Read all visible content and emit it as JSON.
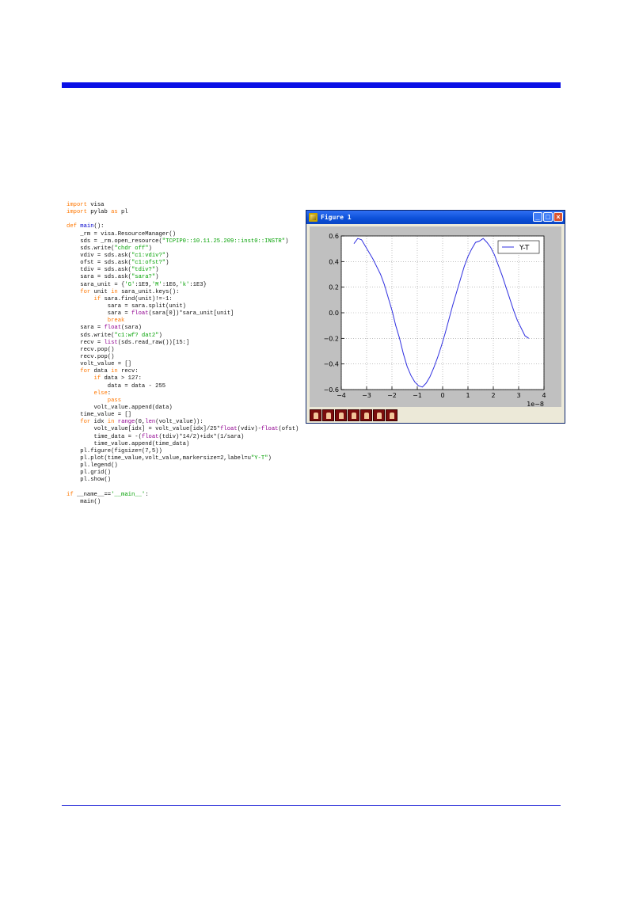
{
  "code_lines": [
    [
      [
        "kw",
        "import"
      ],
      [
        "tx",
        " visa"
      ]
    ],
    [
      [
        "kw",
        "import"
      ],
      [
        "tx",
        " pylab "
      ],
      [
        "kw",
        "as"
      ],
      [
        "tx",
        " pl"
      ]
    ],
    [],
    [
      [
        "kw",
        "def"
      ],
      [
        "tx",
        " "
      ],
      [
        "fn",
        "main"
      ],
      [
        "tx",
        "():"
      ]
    ],
    [
      [
        "tx",
        "    _rm = visa.ResourceManager()"
      ]
    ],
    [
      [
        "tx",
        "    sds = _rm.open_resource("
      ],
      [
        "st",
        "\"TCPIP0::10.11.25.209::inst0::INSTR\""
      ],
      [
        "tx",
        ")"
      ]
    ],
    [
      [
        "tx",
        "    sds.write("
      ],
      [
        "st",
        "\"chdr off\""
      ],
      [
        "tx",
        ")"
      ]
    ],
    [
      [
        "tx",
        "    vdiv = sds.ask("
      ],
      [
        "st",
        "\"c1:vdiv?\""
      ],
      [
        "tx",
        ")"
      ]
    ],
    [
      [
        "tx",
        "    ofst = sds.ask("
      ],
      [
        "st",
        "\"c1:ofst?\""
      ],
      [
        "tx",
        ")"
      ]
    ],
    [
      [
        "tx",
        "    tdiv = sds.ask("
      ],
      [
        "st",
        "\"tdiv?\""
      ],
      [
        "tx",
        ")"
      ]
    ],
    [
      [
        "tx",
        "    sara = sds.ask("
      ],
      [
        "st",
        "\"sara?\""
      ],
      [
        "tx",
        ")"
      ]
    ],
    [
      [
        "tx",
        "    sara_unit = {"
      ],
      [
        "st",
        "'G'"
      ],
      [
        "tx",
        ":1E9,"
      ],
      [
        "st",
        "'M'"
      ],
      [
        "tx",
        ":1E6,"
      ],
      [
        "st",
        "'k'"
      ],
      [
        "tx",
        ":1E3}"
      ]
    ],
    [
      [
        "tx",
        "    "
      ],
      [
        "kw",
        "for"
      ],
      [
        "tx",
        " unit "
      ],
      [
        "kw",
        "in"
      ],
      [
        "tx",
        " sara_unit.keys():"
      ]
    ],
    [
      [
        "tx",
        "        "
      ],
      [
        "kw",
        "if"
      ],
      [
        "tx",
        " sara.find(unit)!=-1:"
      ]
    ],
    [
      [
        "tx",
        "            sara = sara.split(unit)"
      ]
    ],
    [
      [
        "tx",
        "            sara = "
      ],
      [
        "bi",
        "float"
      ],
      [
        "tx",
        "(sara[0])*sara_unit[unit]"
      ]
    ],
    [
      [
        "tx",
        "            "
      ],
      [
        "kw",
        "break"
      ]
    ],
    [
      [
        "tx",
        "    sara = "
      ],
      [
        "bi",
        "float"
      ],
      [
        "tx",
        "(sara)"
      ]
    ],
    [
      [
        "tx",
        "    sds.write("
      ],
      [
        "st",
        "\"c1:wf? dat2\""
      ],
      [
        "tx",
        ")"
      ]
    ],
    [
      [
        "tx",
        "    recv = "
      ],
      [
        "bi",
        "list"
      ],
      [
        "tx",
        "(sds.read_raw())[15:]"
      ]
    ],
    [
      [
        "tx",
        "    recv.pop()"
      ]
    ],
    [
      [
        "tx",
        "    recv.pop()"
      ]
    ],
    [
      [
        "tx",
        "    volt_value = []"
      ]
    ],
    [
      [
        "tx",
        "    "
      ],
      [
        "kw",
        "for"
      ],
      [
        "tx",
        " data "
      ],
      [
        "kw",
        "in"
      ],
      [
        "tx",
        " recv:"
      ]
    ],
    [
      [
        "tx",
        "        "
      ],
      [
        "kw",
        "if"
      ],
      [
        "tx",
        " data > 127:"
      ]
    ],
    [
      [
        "tx",
        "            data = data - 255"
      ]
    ],
    [
      [
        "tx",
        "        "
      ],
      [
        "kw",
        "else"
      ],
      [
        "tx",
        ":"
      ]
    ],
    [
      [
        "tx",
        "            "
      ],
      [
        "kw",
        "pass"
      ]
    ],
    [
      [
        "tx",
        "        volt_value.append(data)"
      ]
    ],
    [
      [
        "tx",
        "    time_value = []"
      ]
    ],
    [
      [
        "tx",
        "    "
      ],
      [
        "kw",
        "for"
      ],
      [
        "tx",
        " idx "
      ],
      [
        "kw",
        "in"
      ],
      [
        "tx",
        " "
      ],
      [
        "bi",
        "range"
      ],
      [
        "tx",
        "(0,"
      ],
      [
        "bi",
        "len"
      ],
      [
        "tx",
        "(volt_value)):"
      ]
    ],
    [
      [
        "tx",
        "        volt_value[idx] = volt_value[idx]/25*"
      ],
      [
        "bi",
        "float"
      ],
      [
        "tx",
        "(vdiv)-"
      ],
      [
        "bi",
        "float"
      ],
      [
        "tx",
        "(ofst)"
      ]
    ],
    [
      [
        "tx",
        "        time_data = -("
      ],
      [
        "bi",
        "float"
      ],
      [
        "tx",
        "(tdiv)*14/2)+idx*(1/sara)"
      ]
    ],
    [
      [
        "tx",
        "        time_value.append(time_data)"
      ]
    ],
    [
      [
        "tx",
        "    pl.figure(figsize=(7,5))"
      ]
    ],
    [
      [
        "tx",
        "    pl.plot(time_value,volt_value,markersize=2,label=u"
      ],
      [
        "st",
        "\"Y-T\""
      ],
      [
        "tx",
        ")"
      ]
    ],
    [
      [
        "tx",
        "    pl.legend()"
      ]
    ],
    [
      [
        "tx",
        "    pl.grid()"
      ]
    ],
    [
      [
        "tx",
        "    pl.show()"
      ]
    ],
    [],
    [
      [
        "kw",
        "if"
      ],
      [
        "tx",
        " __name__=="
      ],
      [
        "st",
        "'__main__'"
      ],
      [
        "tx",
        ":"
      ]
    ],
    [
      [
        "tx",
        "    main()"
      ]
    ]
  ],
  "window": {
    "title": "Figure 1",
    "minimize_glyph": "_",
    "maximize_glyph": "□",
    "close_glyph": "×"
  },
  "toolbar_buttons": [
    "home-icon",
    "back-icon",
    "forward-icon",
    "pan-icon",
    "zoom-icon",
    "subplots-icon",
    "save-icon"
  ],
  "chart_data": {
    "type": "line",
    "xlim": [
      -4,
      4
    ],
    "ylim": [
      -0.6,
      0.6
    ],
    "x_ticks": [
      -4,
      -3,
      -2,
      -1,
      0,
      1,
      2,
      3,
      4
    ],
    "x_tick_labels": [
      "−4",
      "−3",
      "−2",
      "−1",
      "0",
      "1",
      "2",
      "3",
      "4"
    ],
    "y_ticks": [
      -0.6,
      -0.4,
      -0.2,
      0.0,
      0.2,
      0.4,
      0.6
    ],
    "y_tick_labels": [
      "−0.6",
      "−0.4",
      "−0.2",
      "0.0",
      "0.2",
      "0.4",
      "0.6"
    ],
    "x_offset_label": "1e−8",
    "grid": true,
    "legend_position": "top-right",
    "line_color": "#3030e0",
    "series": [
      {
        "name": "Y-T",
        "x": [
          -3.5,
          -3.35,
          -3.2,
          -3.05,
          -2.9,
          -2.75,
          -2.6,
          -2.45,
          -2.3,
          -2.15,
          -2.0,
          -1.85,
          -1.7,
          -1.55,
          -1.4,
          -1.25,
          -1.1,
          -0.95,
          -0.8,
          -0.65,
          -0.5,
          -0.35,
          -0.2,
          -0.05,
          0.1,
          0.25,
          0.4,
          0.55,
          0.7,
          0.85,
          1.0,
          1.15,
          1.3,
          1.45,
          1.6,
          1.75,
          1.9,
          2.05,
          2.2,
          2.35,
          2.5,
          2.65,
          2.8,
          2.95,
          3.1,
          3.25,
          3.4
        ],
        "y": [
          0.54,
          0.58,
          0.57,
          0.52,
          0.47,
          0.42,
          0.36,
          0.3,
          0.22,
          0.12,
          0.02,
          -0.1,
          -0.2,
          -0.32,
          -0.42,
          -0.49,
          -0.54,
          -0.57,
          -0.58,
          -0.55,
          -0.5,
          -0.43,
          -0.35,
          -0.26,
          -0.16,
          -0.05,
          0.06,
          0.16,
          0.26,
          0.36,
          0.44,
          0.5,
          0.55,
          0.56,
          0.58,
          0.55,
          0.51,
          0.45,
          0.37,
          0.29,
          0.2,
          0.11,
          0.02,
          -0.06,
          -0.12,
          -0.18,
          -0.2
        ]
      }
    ]
  }
}
